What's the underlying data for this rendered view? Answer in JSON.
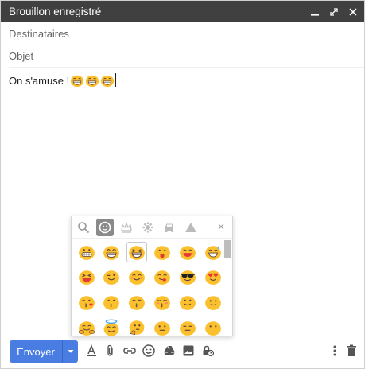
{
  "window": {
    "title": "Brouillon enregistré",
    "minimize_icon": "minimize-icon",
    "expand_icon": "expand-icon",
    "close_icon": "close-icon"
  },
  "fields": {
    "recipients_placeholder": "Destinataires",
    "subject_placeholder": "Objet"
  },
  "body": {
    "text": "On s'amuse !",
    "inline_emoji_count": 3
  },
  "emoji_picker": {
    "tabs": [
      "search-icon",
      "smiley-icon",
      "crown-icon",
      "gear-icon",
      "car-icon",
      "triangle-icon"
    ],
    "active_tab_index": 1,
    "close_label": "×",
    "selected_index": 2
  },
  "toolbar": {
    "send_label": "Envoyer",
    "colors": {
      "send": "#4a7de2",
      "titlebar": "#404040"
    }
  }
}
